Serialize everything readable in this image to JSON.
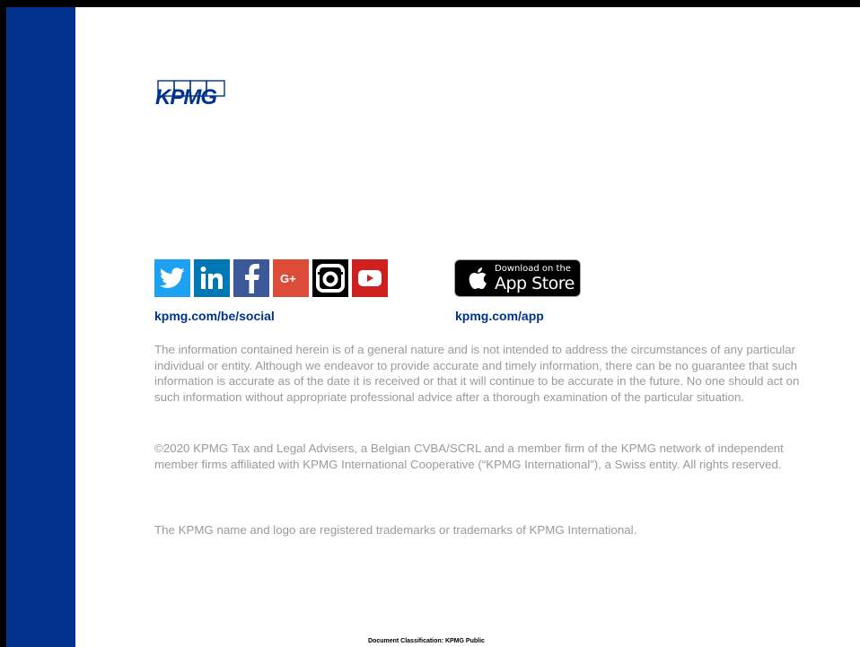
{
  "brand": {
    "logo_text": "KPMG",
    "primary_color": "#00338d",
    "band_color": "#00338d"
  },
  "social": {
    "icons": [
      {
        "name": "twitter",
        "color": "#1da1f2"
      },
      {
        "name": "linkedin",
        "color": "#0077b5"
      },
      {
        "name": "facebook",
        "color": "#3b5998"
      },
      {
        "name": "google-plus",
        "color": "#dd4b39"
      },
      {
        "name": "instagram",
        "color": "#000000"
      },
      {
        "name": "youtube",
        "color": "#cd201f"
      }
    ],
    "link": "kpmg.com/be/social"
  },
  "app": {
    "badge_small": "Download on the",
    "badge_big": "App Store",
    "link": "kpmg.com/app"
  },
  "paragraphs": {
    "disclaimer": "The information contained herein is of a general nature and is not intended to address the circumstances of any particular individual or entity. Although we endeavor to provide accurate and timely information, there can be no guarantee that such information is accurate as of the date it is received or that it will continue to be accurate in the future. No one should act on such information without appropriate professional advice after a thorough examination of the particular situation.",
    "copyright": "©2020 KPMG Tax and Legal Advisers, a Belgian CVBA/SCRL and a member firm of the KPMG network of independent member firms affiliated with KPMG International Cooperative (“KPMG International”), a Swiss entity. All rights reserved.",
    "trademark": "The KPMG name and logo are registered trademarks or trademarks of KPMG International."
  },
  "footer": {
    "classification": "Document Classification: KPMG Public"
  }
}
